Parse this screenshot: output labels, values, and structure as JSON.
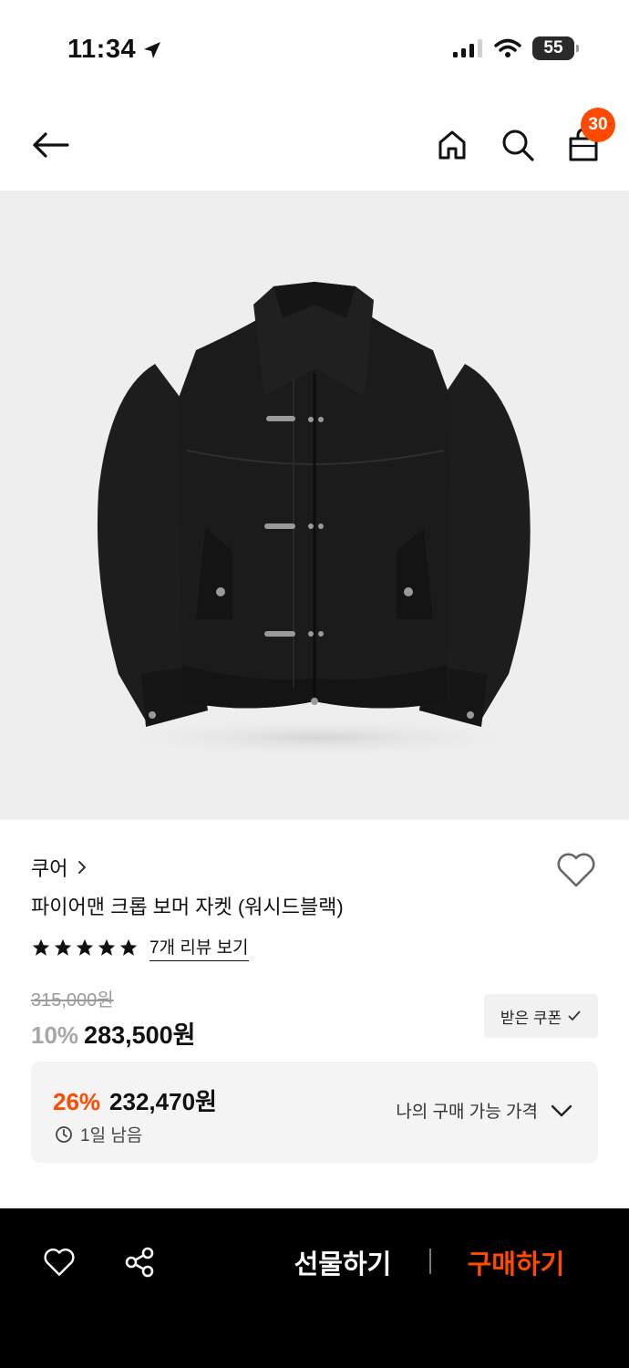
{
  "status_bar": {
    "time": "11:34",
    "battery": "55"
  },
  "header": {
    "cart_count": "30"
  },
  "product": {
    "brand": "쿠어",
    "title": "파이어맨 크롭 보머 자켓 (워시드블랙)",
    "rating_stars": 5,
    "review_link": "7개 리뷰 보기",
    "original_price": "315,000원",
    "discount": "10%",
    "price": "283,500원",
    "coupon_label": "받은 쿠폰"
  },
  "my_price": {
    "discount": "26%",
    "price": "232,470원",
    "remaining": "1일 남음",
    "label": "나의 구매 가능 가격"
  },
  "bottom_bar": {
    "gift_label": "선물하기",
    "buy_label": "구매하기"
  },
  "colors": {
    "accent": "#ff4a00",
    "image_bg": "#eeeeee",
    "bottom_bar": "#000000"
  },
  "icons": [
    "location-arrow-icon",
    "signal-icon",
    "wifi-icon",
    "back-arrow-icon",
    "home-icon",
    "search-icon",
    "shopping-bag-icon",
    "heart-icon",
    "star-icon",
    "checkmark-icon",
    "clock-icon",
    "chevron-down-icon",
    "share-icon"
  ]
}
